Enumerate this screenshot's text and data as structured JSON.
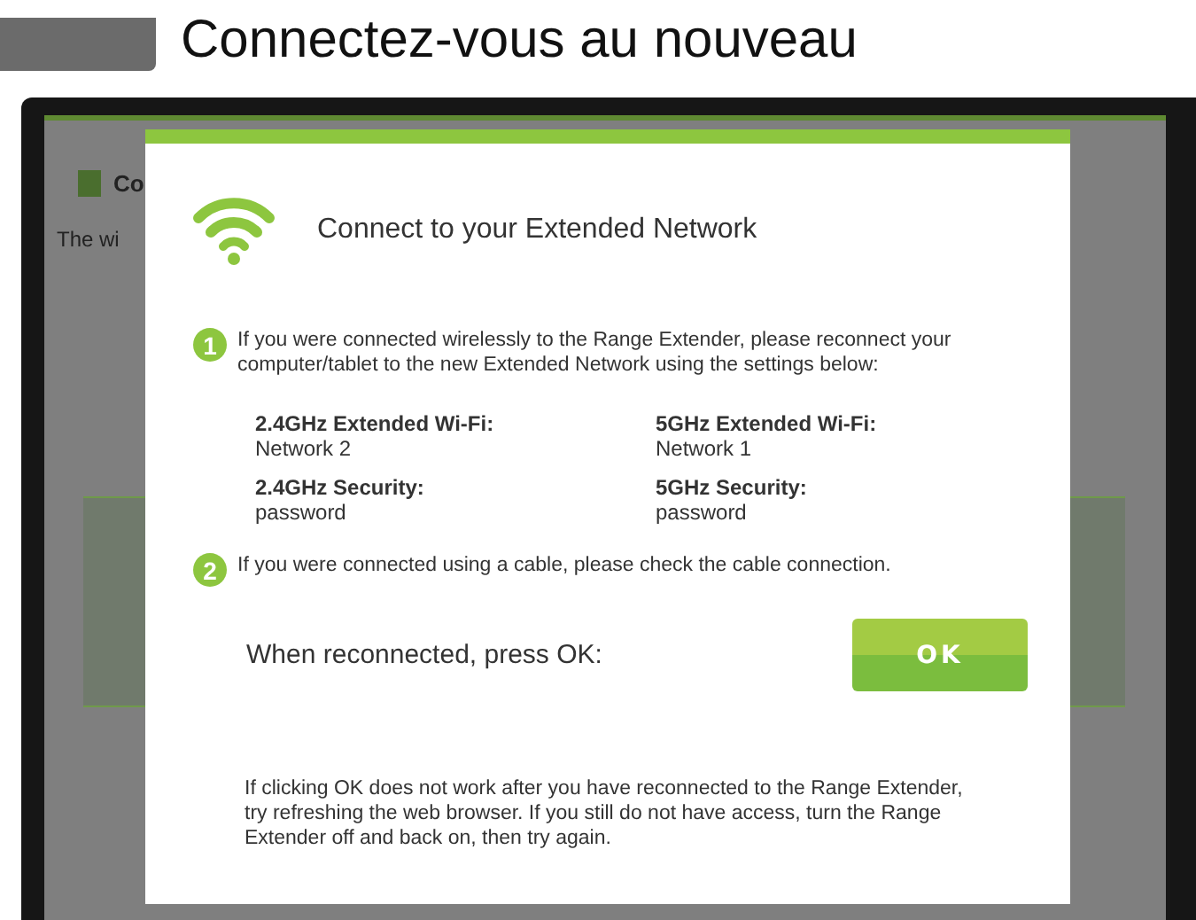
{
  "page_title": "Connectez-vous au nouveau",
  "background_page": {
    "heading": "Co",
    "text": "The wi"
  },
  "dialog": {
    "title": "Connect to your Extended Network",
    "steps": [
      {
        "number": "1",
        "text": "If you were connected wirelessly to the Range Extender, please reconnect your computer/tablet to the new Extended Network using the settings below:"
      },
      {
        "number": "2",
        "text": "If you were connected using a cable, please check the cable connection."
      }
    ],
    "settings": [
      {
        "label": "2.4GHz Extended Wi-Fi:",
        "value": "Network 2"
      },
      {
        "label": "5GHz Extended Wi-Fi:",
        "value": "Network 1"
      },
      {
        "label": "2.4GHz Security:",
        "value": "password"
      },
      {
        "label": "5GHz Security:",
        "value": "password"
      }
    ],
    "prompt": "When reconnected, press OK:",
    "ok_button": "OK",
    "footnote": "If clicking OK does not work after you have reconnected to the Range Extender, try refreshing the web browser. If you still do not have access, turn the Range Extender off and back on, then try again."
  }
}
